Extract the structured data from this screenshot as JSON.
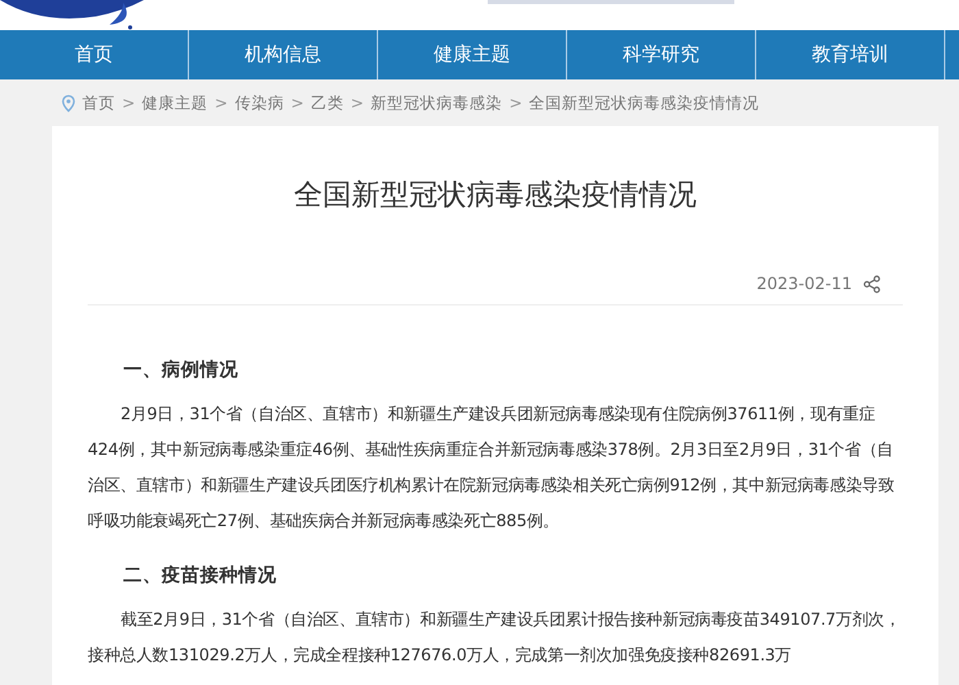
{
  "nav": [
    {
      "label": "首页",
      "selected": false
    },
    {
      "label": "机构信息",
      "selected": false
    },
    {
      "label": "健康主题",
      "selected": false
    },
    {
      "label": "科学研究",
      "selected": false
    },
    {
      "label": "教育培训",
      "selected": false
    }
  ],
  "breadcrumb": [
    "首页",
    "健康主题",
    "传染病",
    "乙类",
    "新型冠状病毒感染",
    "全国新型冠状病毒感染疫情情况"
  ],
  "breadcrumb_separator": ">",
  "article": {
    "title": "全国新型冠状病毒感染疫情情况",
    "date": "2023-02-11",
    "sections": [
      {
        "heading": "一、病例情况",
        "paragraphs": [
          "2月9日，31个省（自治区、直辖市）和新疆生产建设兵团新冠病毒感染现有住院病例37611例，现有重症424例，其中新冠病毒感染重症46例、基础性疾病重症合并新冠病毒感染378例。2月3日至2月9日，31个省（自治区、直辖市）和新疆生产建设兵团医疗机构累计在院新冠病毒感染相关死亡病例912例，其中新冠病毒感染导致呼吸功能衰竭死亡27例、基础疾病合并新冠病毒感染死亡885例。"
        ]
      },
      {
        "heading": "二、疫苗接种情况",
        "paragraphs": [
          "截至2月9日，31个省（自治区、直辖市）和新疆生产建设兵团累计报告接种新冠病毒疫苗349107.7万剂次，接种总人数131029.2万人，完成全程接种127676.0万人，完成第一剂次加强免疫接种82691.3万"
        ]
      }
    ]
  }
}
